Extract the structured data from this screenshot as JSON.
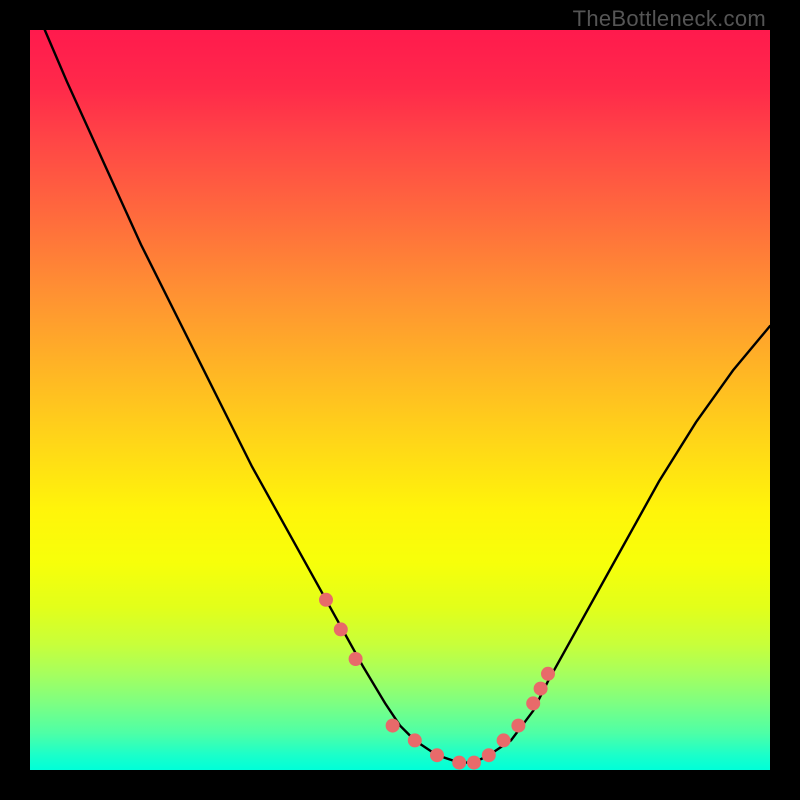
{
  "watermark": "TheBottleneck.com",
  "chart_data": {
    "type": "line",
    "title": "",
    "xlabel": "",
    "ylabel": "",
    "xlim": [
      0,
      100
    ],
    "ylim": [
      0,
      100
    ],
    "grid": false,
    "legend": false,
    "series": [
      {
        "name": "bottleneck-curve",
        "color": "#000000",
        "x": [
          2,
          5,
          10,
          15,
          20,
          25,
          30,
          35,
          40,
          45,
          48,
          50,
          52,
          55,
          58,
          60,
          62,
          65,
          68,
          70,
          75,
          80,
          85,
          90,
          95,
          100
        ],
        "y": [
          100,
          93,
          82,
          71,
          61,
          51,
          41,
          32,
          23,
          14,
          9,
          6,
          4,
          2,
          1,
          1,
          2,
          4,
          8,
          12,
          21,
          30,
          39,
          47,
          54,
          60
        ]
      }
    ],
    "markers": {
      "name": "highlight-dots",
      "color": "#e86a6a",
      "radius": 7,
      "x": [
        40,
        42,
        44,
        49,
        52,
        55,
        58,
        60,
        62,
        64,
        66,
        68,
        69,
        70
      ],
      "y": [
        23,
        19,
        15,
        6,
        4,
        2,
        1,
        1,
        2,
        4,
        6,
        9,
        11,
        13
      ]
    }
  }
}
